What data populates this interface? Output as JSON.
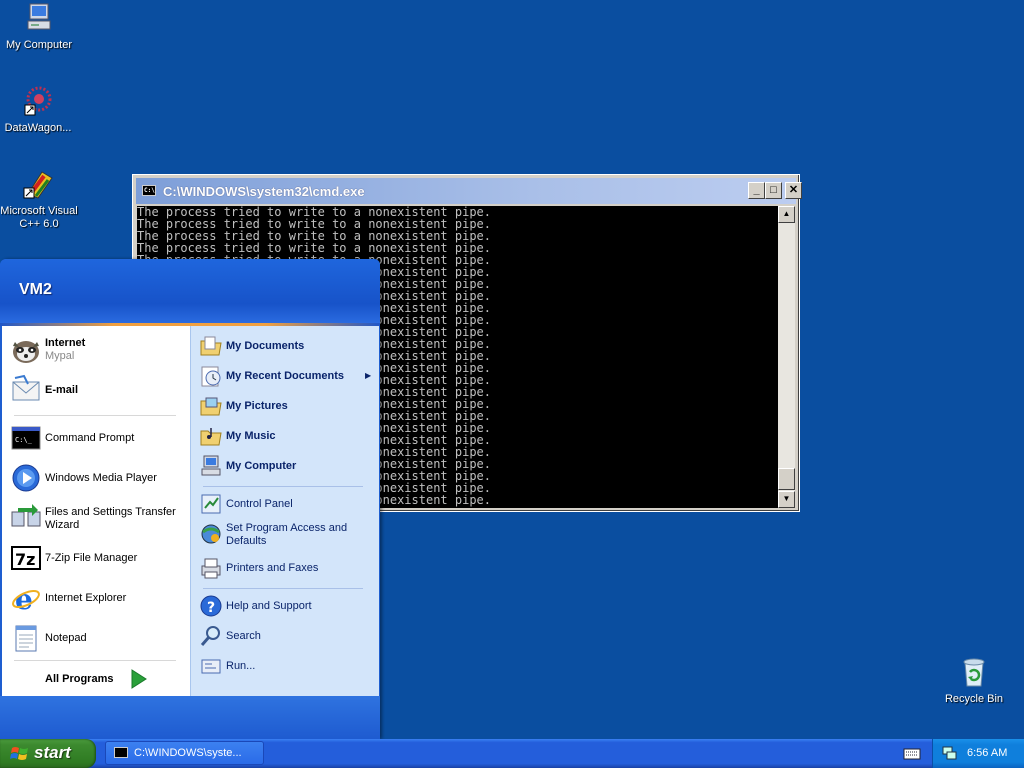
{
  "desktop": {
    "icons": [
      {
        "label": "My Computer",
        "icon": "my-computer-icon"
      },
      {
        "label": "DataWagon...",
        "icon": "datawagon-icon"
      },
      {
        "label": "Microsoft Visual C++ 6.0",
        "icon": "visual-cpp-icon"
      },
      {
        "label": "Recycle Bin",
        "icon": "recycle-bin-icon"
      }
    ]
  },
  "cmd_window": {
    "title": "C:\\WINDOWS\\system32\\cmd.exe",
    "line": "The process tried to write to a nonexistent pipe.",
    "line_count": 25,
    "buttons": {
      "minimize": "_",
      "maximize": "□",
      "close": "✕"
    }
  },
  "start_menu": {
    "user": "VM2",
    "pinned": [
      {
        "label": "Internet",
        "sub": "Mypal",
        "icon": "mypal-raccoon-icon"
      },
      {
        "label": "E-mail",
        "icon": "email-icon"
      }
    ],
    "recent": [
      {
        "label": "Command Prompt",
        "icon": "command-prompt-icon"
      },
      {
        "label": "Windows Media Player",
        "icon": "media-player-icon"
      },
      {
        "label": "Files and Settings Transfer Wizard",
        "icon": "transfer-wizard-icon"
      },
      {
        "label": "7-Zip File Manager",
        "icon": "7zip-icon"
      },
      {
        "label": "Internet Explorer",
        "icon": "internet-explorer-icon"
      },
      {
        "label": "Notepad",
        "icon": "notepad-icon"
      }
    ],
    "all_programs": "All Programs",
    "places": [
      {
        "label": "My Documents",
        "icon": "folder-documents-icon"
      },
      {
        "label": "My Recent Documents",
        "icon": "recent-documents-icon"
      },
      {
        "label": "My Pictures",
        "icon": "folder-pictures-icon"
      },
      {
        "label": "My Music",
        "icon": "folder-music-icon"
      },
      {
        "label": "My Computer",
        "icon": "my-computer-icon"
      }
    ],
    "system": [
      {
        "label": "Control Panel",
        "icon": "control-panel-icon"
      },
      {
        "label": "Set Program Access and Defaults",
        "icon": "program-access-icon"
      },
      {
        "label": "Printers and Faxes",
        "icon": "printer-icon"
      }
    ],
    "help": [
      {
        "label": "Help and Support",
        "icon": "help-icon"
      },
      {
        "label": "Search",
        "icon": "search-icon"
      },
      {
        "label": "Run...",
        "icon": "run-icon"
      }
    ]
  },
  "taskbar": {
    "start_label": "start",
    "task_label": "C:\\WINDOWS\\syste...",
    "clock": "6:56 AM"
  },
  "colors": {
    "desktop": "#0a4ea0",
    "taskbar": "#245edb",
    "start_button": "#3c8a2f",
    "menu_left": "#ffffff",
    "menu_right": "#d3e5fa"
  }
}
